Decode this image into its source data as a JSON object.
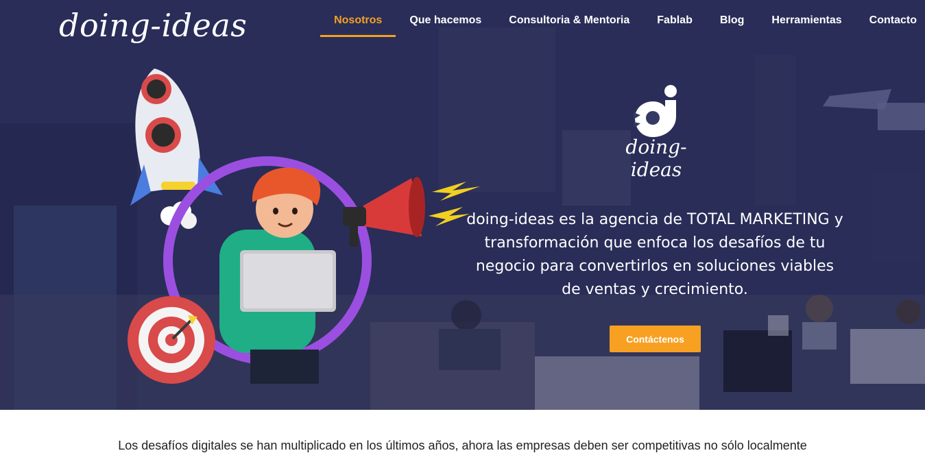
{
  "header": {
    "logo_text": "doing-ideas",
    "nav": [
      {
        "label": "Nosotros",
        "active": true
      },
      {
        "label": "Que hacemos",
        "active": false
      },
      {
        "label": "Consultoria & Mentoria",
        "active": false
      },
      {
        "label": "Fablab",
        "active": false
      },
      {
        "label": "Blog",
        "active": false
      },
      {
        "label": "Herramientas",
        "active": false
      },
      {
        "label": "Contacto",
        "active": false
      }
    ]
  },
  "hero": {
    "brand_name": "doing-ideas",
    "tagline": "doing-ideas es la agencia de TOTAL MARKETING y transformación que enfoca los desafíos de tu negocio para convertirlos en soluciones viables de ventas y crecimiento.",
    "cta_label": "Contáctenos"
  },
  "intro": {
    "text": "Los desafíos digitales se han multiplicado en los últimos años, ahora las empresas deben ser competitivas no sólo localmente"
  },
  "colors": {
    "accent": "#f7a021",
    "hero_overlay": "#2a3058",
    "text_light": "#ffffff"
  },
  "icons": [
    "brand-logo-icon",
    "rocket-icon",
    "megaphone-icon",
    "lightning-icon",
    "target-icon",
    "laptop-icon"
  ]
}
